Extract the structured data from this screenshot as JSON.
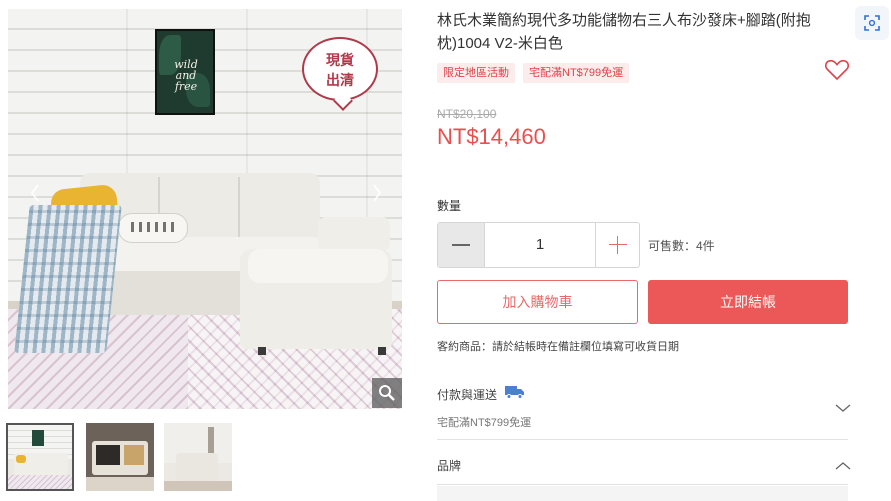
{
  "gallery": {
    "main_image": {
      "poster_text": "wild and free",
      "badge_line1": "現貨",
      "badge_line2": "出清"
    },
    "prev_icon": "chevron-left-icon",
    "next_icon": "chevron-right-icon",
    "zoom_icon": "magnifier-icon",
    "thumbnails_count": 3
  },
  "product": {
    "title": "林氏木業簡約現代多功能儲物右三人布沙發床+腳踏(附抱枕)1004 V2-米白色",
    "tags": [
      "限定地區活動",
      "宅配滿NT$799免運"
    ],
    "wishlist_icon": "heart-icon",
    "price_original": "NT$20,100",
    "price_sale": "NT$14,460"
  },
  "quantity": {
    "label": "數量",
    "value": "1",
    "stock": "可售數：4件"
  },
  "actions": {
    "add_to_cart": "加入購物車",
    "buy_now": "立即結帳"
  },
  "note": "客約商品：請於結帳時在備註欄位填寫可收貨日期",
  "sections": {
    "shipping_title": "付款與運送",
    "shipping_sub": "宅配滿NT$799免運",
    "brand_title": "品牌"
  },
  "colors": {
    "accent": "#ec5757",
    "tag_bg": "#fdecec",
    "badge": "#b13a4a"
  }
}
